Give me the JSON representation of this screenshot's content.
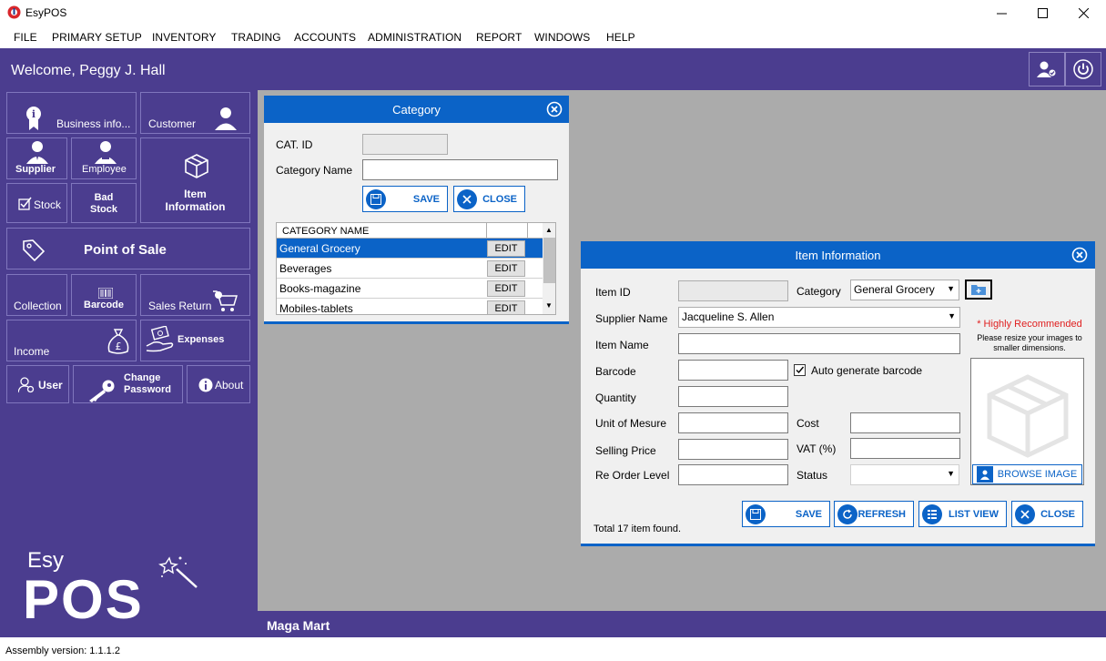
{
  "window": {
    "title": "EsyPOS"
  },
  "menu": [
    "FILE",
    "PRIMARY SETUP",
    "INVENTORY",
    "TRADING",
    "ACCOUNTS",
    "ADMINISTRATION",
    "REPORT",
    "WINDOWS",
    "HELP"
  ],
  "header": {
    "welcome": "Welcome, Peggy J. Hall"
  },
  "sidebar": {
    "business_info": "Business info...",
    "customer": "Customer",
    "supplier": "Supplier",
    "employee": "Employee",
    "stock": "Stock",
    "bad_stock_1": "Bad",
    "bad_stock_2": "Stock",
    "item_info_1": "Item",
    "item_info_2": "Information",
    "pos": "Point of Sale",
    "collection": "Collection",
    "barcode": "Barcode",
    "sales_return": "Sales Return",
    "income": "Income",
    "expenses": "Expenses",
    "user": "User",
    "change_password_1": "Change",
    "change_password_2": "Password",
    "about": "About"
  },
  "logo": {
    "top": "Esy",
    "bottom": "POS"
  },
  "category_dialog": {
    "title": "Category",
    "cat_id_label": "CAT. ID",
    "cat_id_value": "",
    "name_label": "Category Name",
    "name_value": "",
    "save": "SAVE",
    "close": "CLOSE",
    "table_header": "CATEGORY NAME",
    "rows": [
      {
        "name": "General Grocery",
        "action": "EDIT"
      },
      {
        "name": "Beverages",
        "action": "EDIT"
      },
      {
        "name": "Books-magazine",
        "action": "EDIT"
      },
      {
        "name": "Mobiles-tablets",
        "action": "EDIT"
      }
    ]
  },
  "item_dialog": {
    "title": "Item Information",
    "item_id_label": "Item ID",
    "category_label": "Category",
    "category_value": "General Grocery",
    "supplier_label": "Supplier Name",
    "supplier_value": "Jacqueline S. Allen",
    "item_name_label": "Item Name",
    "barcode_label": "Barcode",
    "auto_barcode": "Auto generate barcode",
    "auto_barcode_checked": true,
    "quantity_label": "Quantity",
    "unit_label": "Unit of Mesure",
    "cost_label": "Cost",
    "selling_label": "Selling Price",
    "vat_label": "VAT (%)",
    "reorder_label": "Re Order Level",
    "status_label": "Status",
    "highly_recommended": "* Highly Recommended",
    "resize_note": "Please resize your images to smaller dimensions.",
    "browse": "BROWSE IMAGE",
    "save": "SAVE",
    "refresh": "REFRESH",
    "list_view": "LIST VIEW",
    "close": "CLOSE",
    "total": "Total 17 item found."
  },
  "status_strip": {
    "store": "Maga Mart"
  },
  "footer": {
    "assembly": "Assembly version: 1.1.1.2"
  },
  "colors": {
    "primary": "#4b3d8f",
    "accent": "#0b63c7",
    "workspace": "#ababab",
    "recommended": "#e02020"
  }
}
